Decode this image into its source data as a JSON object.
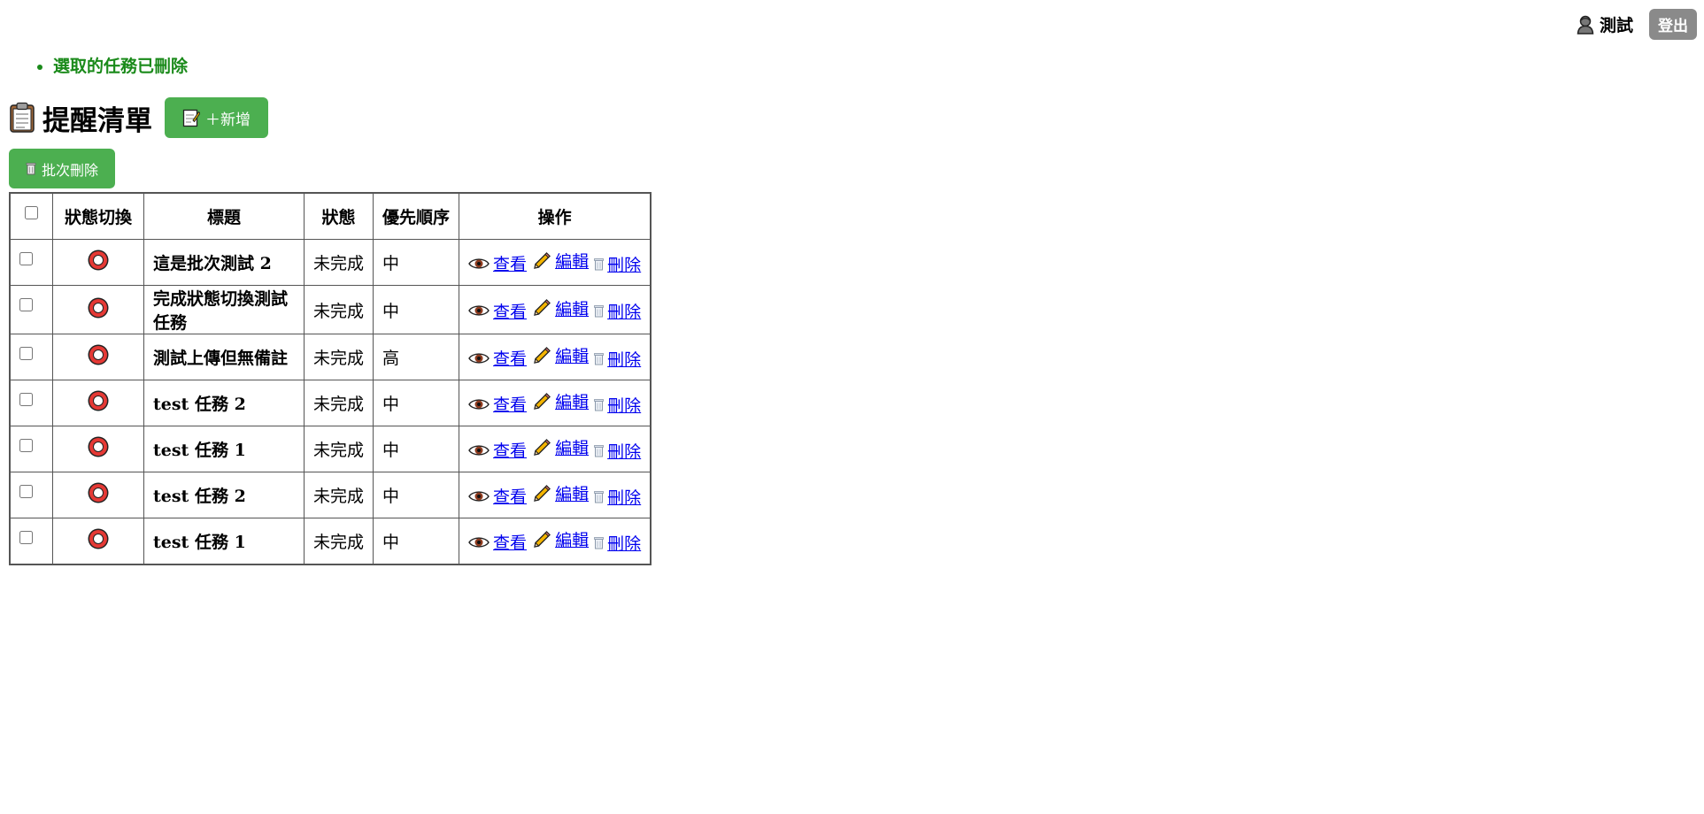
{
  "header": {
    "username": "測試",
    "logout_label": "登出"
  },
  "flash": {
    "message": "選取的任務已刪除",
    "color": "#1a8a1a"
  },
  "page": {
    "title": "提醒清單",
    "add_label": "＋新增",
    "batch_delete_label": "批次刪除"
  },
  "table": {
    "columns": [
      "狀態切換",
      "標題",
      "狀態",
      "優先順序",
      "操作"
    ],
    "actions": {
      "view": "查看",
      "edit": "編輯",
      "delete": "刪除"
    },
    "rows": [
      {
        "title": "這是批次測試 2",
        "status": "未完成",
        "priority": "中"
      },
      {
        "title": "完成狀態切換測試任務",
        "status": "未完成",
        "priority": "中"
      },
      {
        "title": "測試上傳但無備註",
        "status": "未完成",
        "priority": "高"
      },
      {
        "title": "test 任務 2",
        "status": "未完成",
        "priority": "中"
      },
      {
        "title": "test 任務 1",
        "status": "未完成",
        "priority": "中"
      },
      {
        "title": "test 任務 2",
        "status": "未完成",
        "priority": "中"
      },
      {
        "title": "test 任務 1",
        "status": "未完成",
        "priority": "中"
      }
    ]
  },
  "icons": {
    "user": "user-silhouette-icon",
    "title": "clipboard-icon",
    "add": "memo-icon",
    "batch_delete": "trash-icon",
    "toggle": "hollow-red-circle-icon",
    "view": "eye-icon",
    "edit": "pencil-icon",
    "delete": "trash-icon"
  },
  "colors": {
    "primary_button": "#4caf50",
    "logout_button": "#8a8a8a",
    "link": "#0000ee",
    "toggle_red": "#e53935"
  }
}
